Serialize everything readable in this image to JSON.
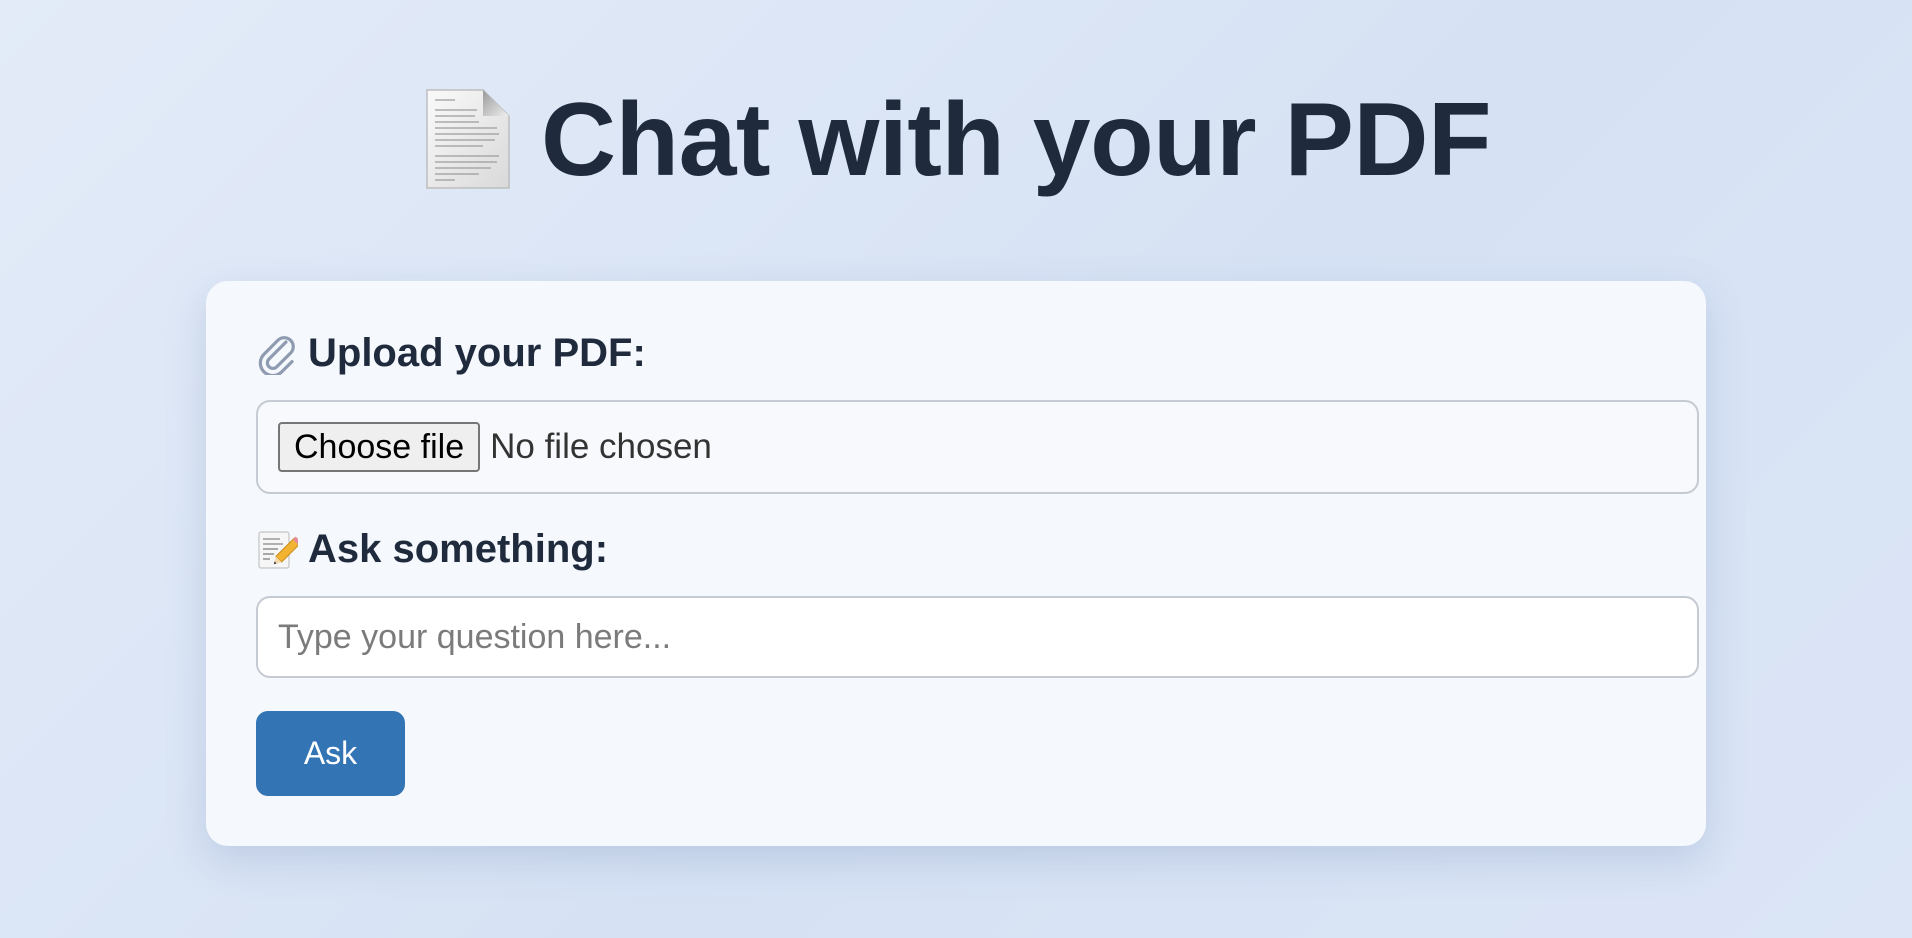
{
  "header": {
    "title": "Chat with your PDF",
    "icon": "page-facing-up-icon"
  },
  "upload": {
    "label": "Upload your PDF:",
    "icon": "paperclip-icon",
    "choose_button_label": "Choose file",
    "status_text": "No file chosen"
  },
  "ask": {
    "label": "Ask something:",
    "icon": "memo-pencil-icon",
    "input_value": "",
    "input_placeholder": "Type your question here..."
  },
  "submit": {
    "label": "Ask"
  },
  "colors": {
    "background": "#dbe5f6",
    "card": "#f5f8fd",
    "text": "#1f2a3c",
    "accent": "#3374b4"
  }
}
